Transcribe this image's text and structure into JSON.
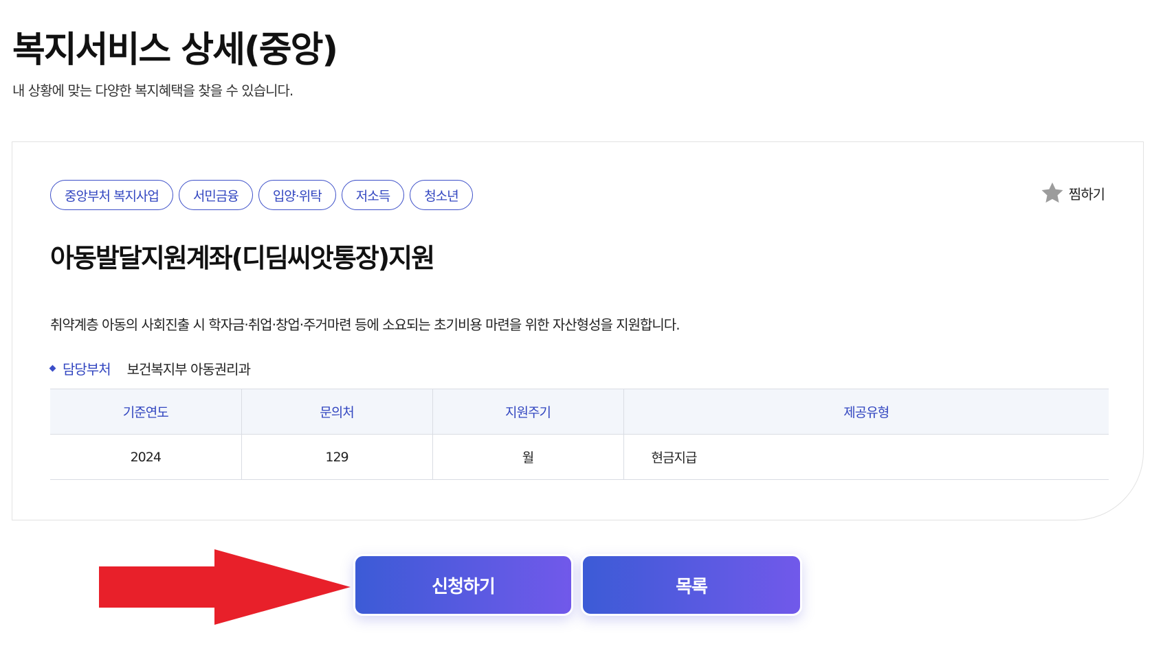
{
  "header": {
    "title": "복지서비스 상세(중앙)",
    "subtitle": "내 상황에 맞는 다양한 복지혜택을 찾을 수 있습니다."
  },
  "card": {
    "tags": [
      "중앙부처 복지사업",
      "서민금융",
      "입양·위탁",
      "저소득",
      "청소년"
    ],
    "favorite": {
      "label": "찜하기",
      "icon": "star-icon"
    },
    "service_title": "아동발달지원계좌(디딤씨앗통장)지원",
    "description": "취약계층 아동의 사회진출 시 학자금·취업·창업·주거마련 등에 소요되는 초기비용 마련을 위한 자산형성을 지원합니다.",
    "department": {
      "label": "담당부처",
      "value": "보건복지부 아동권리과"
    },
    "table": {
      "headers": [
        "기준연도",
        "문의처",
        "지원주기",
        "제공유형"
      ],
      "row": [
        "2024",
        "129",
        "월",
        "현금지급"
      ]
    }
  },
  "actions": {
    "apply_label": "신청하기",
    "list_label": "목록"
  },
  "colors": {
    "accent": "#3246c0",
    "button_gradient_start": "#3c5bd6",
    "button_gradient_end": "#7159ea",
    "arrow": "#e8202a"
  }
}
